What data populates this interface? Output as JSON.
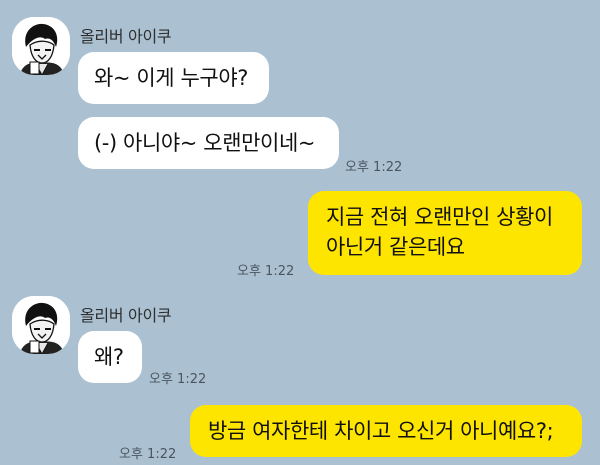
{
  "colors": {
    "background": "#abc1d1",
    "incoming_bubble": "#ffffff",
    "outgoing_bubble": "#fee500"
  },
  "groups": [
    {
      "sender": "올리버 아이쿠",
      "avatar_icon": "profile-avatar-icon",
      "messages": [
        "와~ 이게 누구야?",
        "(-) 아니야~ 오랜만이네~"
      ],
      "time": "오후 1:22"
    },
    {
      "sender": "me",
      "lines": [
        "지금 전혀 오랜만인 상황이",
        "아닌거 같은데요"
      ],
      "time": "오후 1:22"
    },
    {
      "sender": "올리버 아이쿠",
      "avatar_icon": "profile-avatar-icon",
      "messages": [
        "왜?"
      ],
      "time": "오후 1:22"
    },
    {
      "sender": "me",
      "lines": [
        "방금 여자한테 차이고 오신거 아니예요?;"
      ],
      "time": "오후 1:22"
    }
  ]
}
